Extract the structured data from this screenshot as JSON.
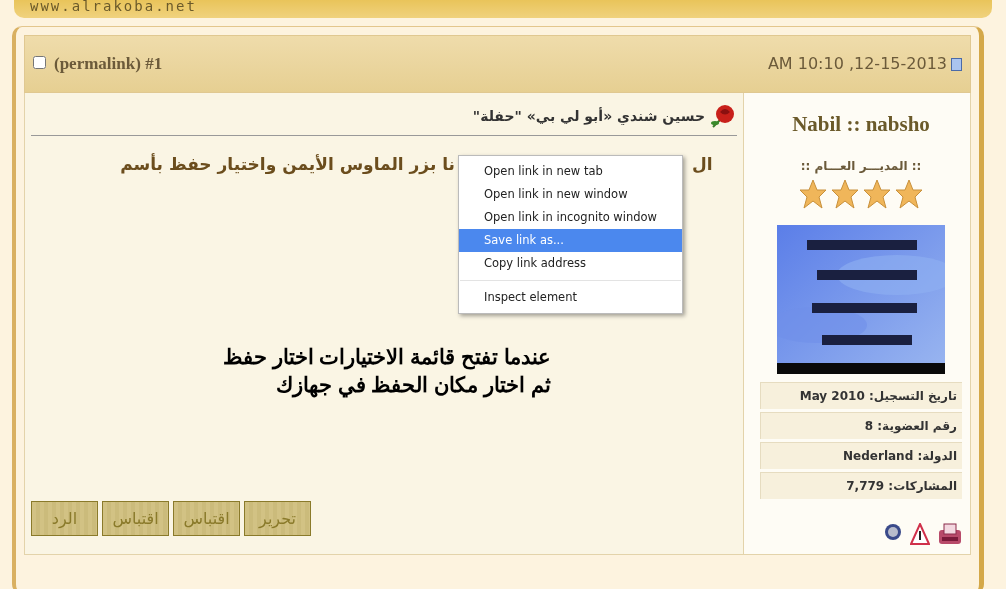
{
  "banner": {
    "url": "www.alrakoba.net"
  },
  "post_header": {
    "checkbox": {
      "checked": false
    },
    "permalink": "(permalink)",
    "number": "#1",
    "date": "AM 10:10 ,12-15-2013"
  },
  "post": {
    "title": "حسين شندي «أبو لي بي» \"حفلة\"",
    "text_fragments": [
      "ال",
      "نا بزر الماوس الأيمن واختيار حفظ بأسم"
    ],
    "message_lines": [
      "عندما تفتح قائمة الاختيارات اختار حفظ",
      "ثم اختار مكان الحفظ في جهازك"
    ],
    "buttons": [
      "تحرير",
      "اقتباس",
      "اقتباس",
      "الرد"
    ]
  },
  "context_menu": [
    {
      "label": "Open link in new tab",
      "selected": false
    },
    {
      "label": "Open link in new window",
      "selected": false
    },
    {
      "label": "Open link in incognito window",
      "selected": false
    },
    {
      "label": "Save link as...",
      "selected": true
    },
    {
      "label": "Copy link address",
      "selected": false
    },
    {
      "kind": "separator"
    },
    {
      "label": "Inspect element",
      "selected": false
    }
  ],
  "user": {
    "name": "Nabil :: nabsho",
    "rank": ":: المديـــر العـــام ::",
    "stars": 4,
    "info": [
      "تاريخ التسجيل: May 2010",
      "رقم العضوية: 8",
      "الدولة: Nederland",
      "المشاركات: 7,779"
    ]
  }
}
